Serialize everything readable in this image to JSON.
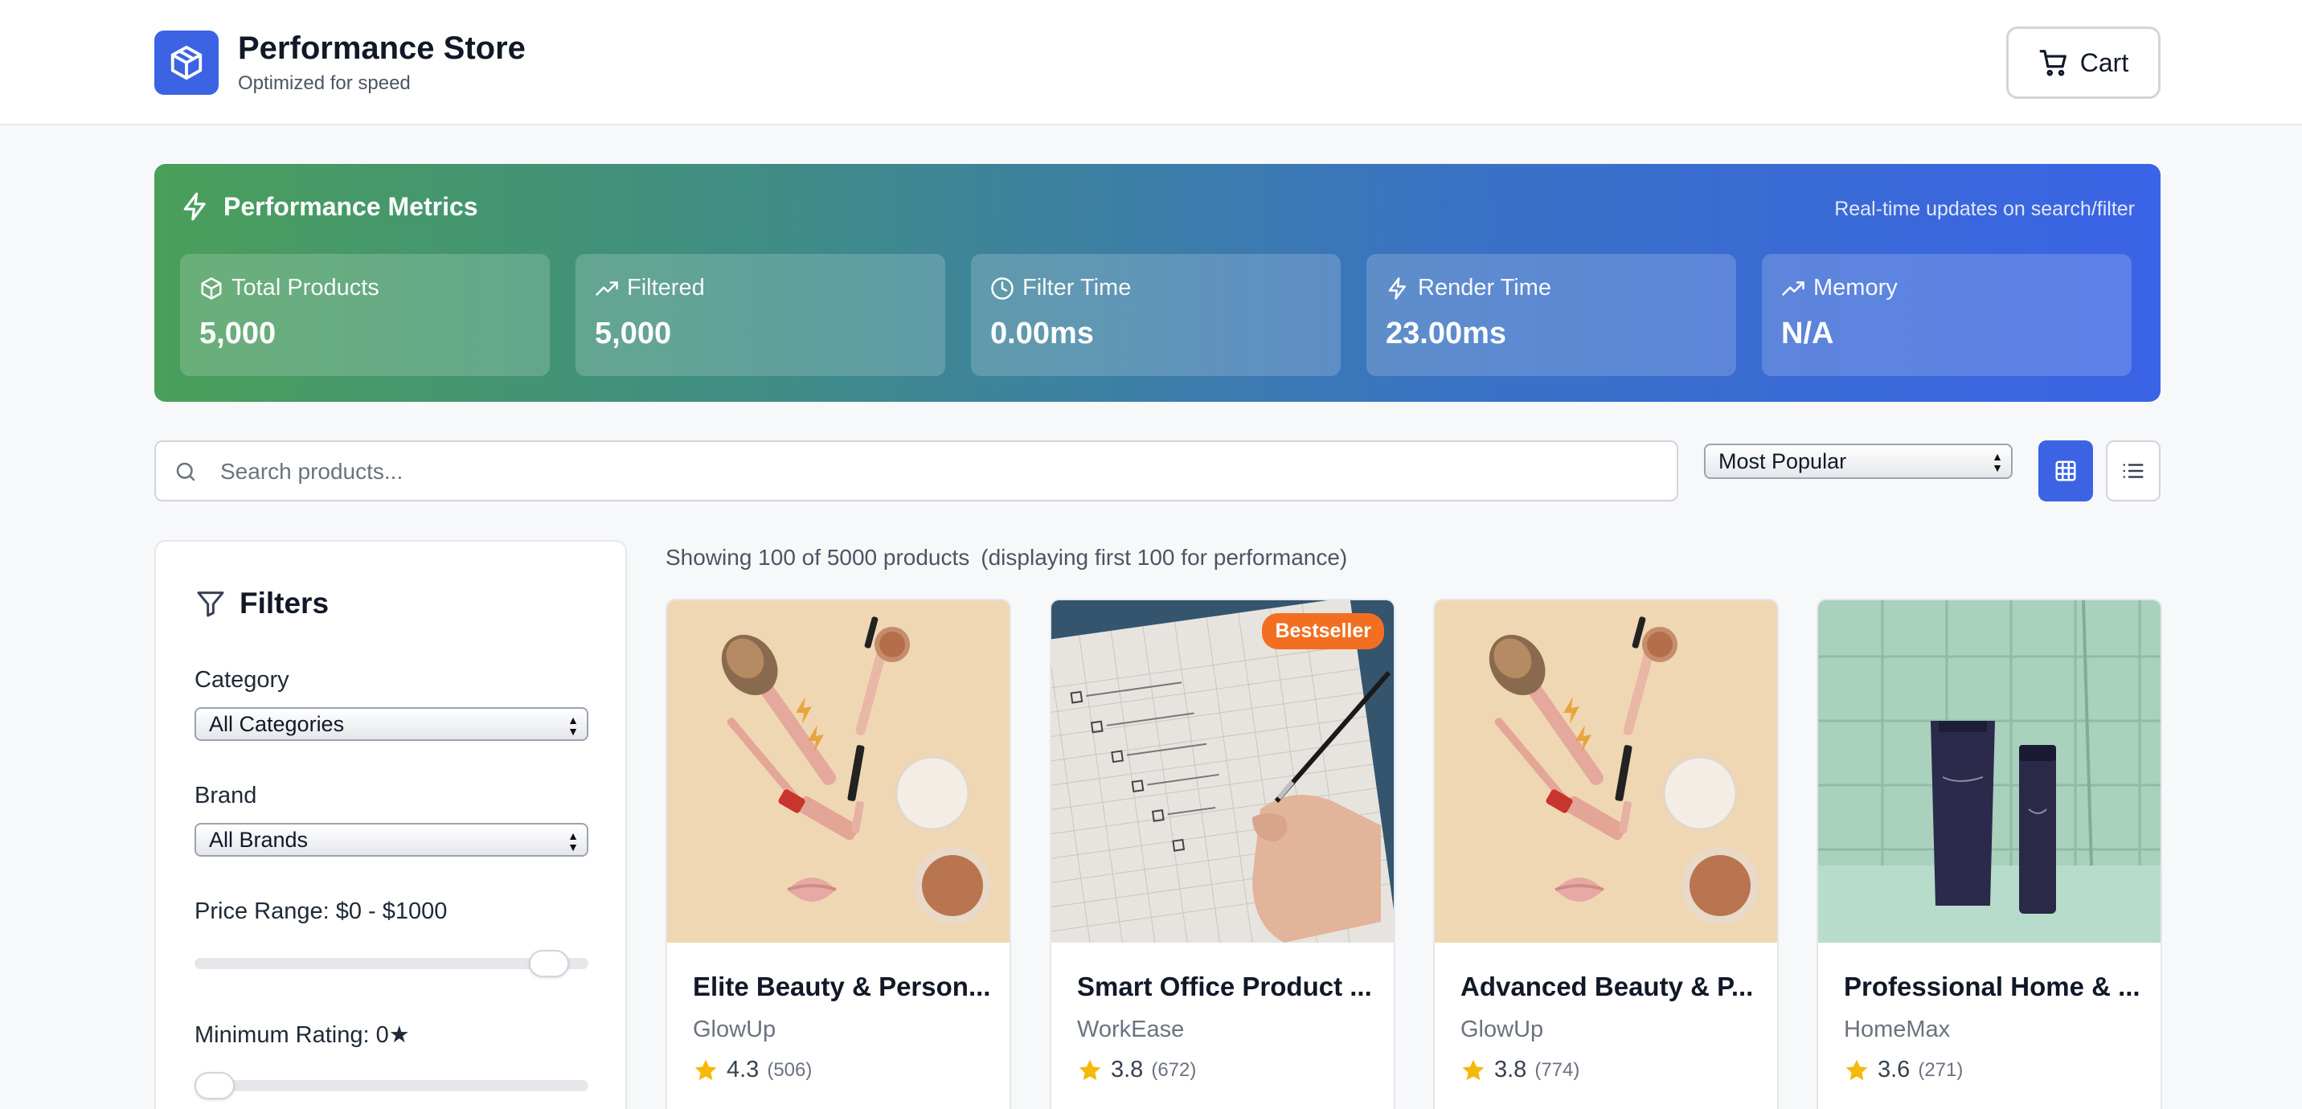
{
  "header": {
    "title": "Performance Store",
    "subtitle": "Optimized for speed",
    "cart_label": "Cart"
  },
  "metrics": {
    "title": "Performance Metrics",
    "note": "Real-time updates on search/filter",
    "cards": [
      {
        "label": "Total Products",
        "value": "5,000",
        "icon": "box-icon"
      },
      {
        "label": "Filtered",
        "value": "5,000",
        "icon": "trending-up-icon"
      },
      {
        "label": "Filter Time",
        "value": "0.00ms",
        "icon": "clock-icon"
      },
      {
        "label": "Render Time",
        "value": "23.00ms",
        "icon": "zap-icon"
      },
      {
        "label": "Memory",
        "value": "N/A",
        "icon": "trending-up-icon"
      }
    ]
  },
  "search": {
    "placeholder": "Search products...",
    "value": ""
  },
  "sort": {
    "selected": "Most Popular"
  },
  "view": {
    "active": "grid"
  },
  "filters": {
    "title": "Filters",
    "category_label": "Category",
    "category_selected": "All Categories",
    "brand_label": "Brand",
    "brand_selected": "All Brands",
    "price_label": "Price Range: $0 - $1000",
    "price_max_fraction": 1.0,
    "rating_label": "Minimum Rating: 0★",
    "rating_fraction": 0.0
  },
  "results": {
    "showing": "Showing 100 of 5000 products",
    "note": "(displaying first 100 for performance)"
  },
  "products": [
    {
      "title": "Elite Beauty & Person...",
      "brand": "GlowUp",
      "rating": "4.3",
      "count": "(506)",
      "badge": "",
      "image": "makeup"
    },
    {
      "title": "Smart Office Product ...",
      "brand": "WorkEase",
      "rating": "3.8",
      "count": "(672)",
      "badge": "Bestseller",
      "image": "notebook"
    },
    {
      "title": "Advanced Beauty & P...",
      "brand": "GlowUp",
      "rating": "3.8",
      "count": "(774)",
      "badge": "",
      "image": "makeup"
    },
    {
      "title": "Professional Home & ...",
      "brand": "HomeMax",
      "rating": "3.6",
      "count": "(271)",
      "badge": "",
      "image": "bottles"
    }
  ],
  "colors": {
    "accent": "#3b63e4",
    "badge": "#f26f21",
    "star": "#f5b90a"
  }
}
